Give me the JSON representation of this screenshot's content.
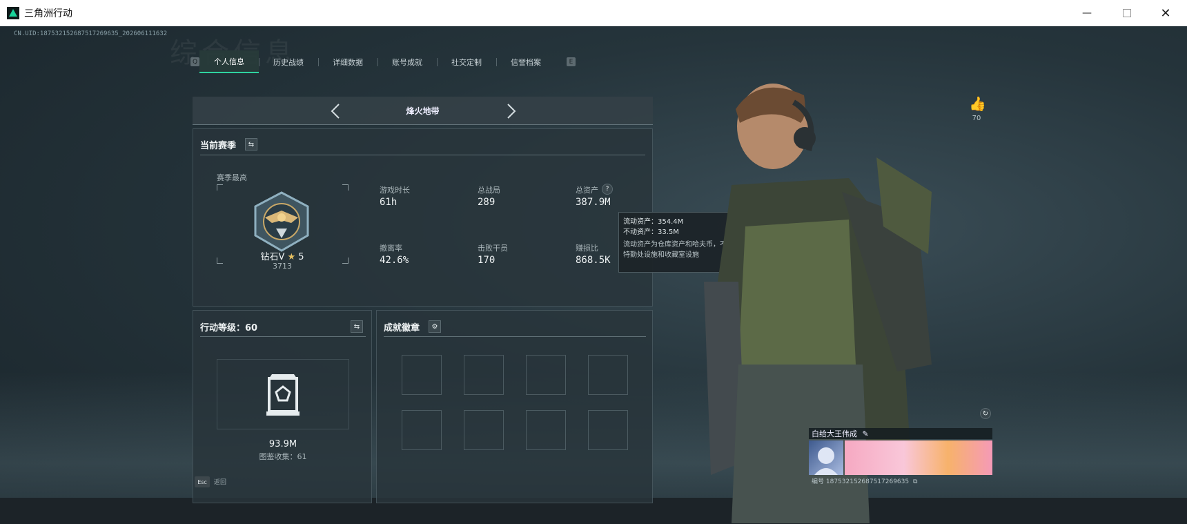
{
  "window": {
    "title": "三角洲行动",
    "minimize_icon": "minimize-icon",
    "maximize_icon": "maximize-icon",
    "close_icon": "close-icon"
  },
  "uid_text": "CN.UID:18753215268751726963​5_20260611163​2",
  "background_word": "综合信息",
  "tabs": {
    "prev_key": "Q",
    "next_key": "E",
    "items": [
      {
        "label": "个人信息",
        "active": true
      },
      {
        "label": "历史战绩",
        "active": false
      },
      {
        "label": "详细数据",
        "active": false
      },
      {
        "label": "账号成就",
        "active": false
      },
      {
        "label": "社交定制",
        "active": false
      },
      {
        "label": "信誉档案",
        "active": false
      }
    ]
  },
  "mode": {
    "title": "烽火地带",
    "prev_icon": "chevron-left-icon",
    "next_icon": "chevron-right-icon"
  },
  "season": {
    "title": "当前赛季",
    "switch_icon": "swap-icon",
    "highest_label": "赛季最高",
    "rank_name": "钻石V",
    "rank_stars": "5",
    "rank_points": "3713",
    "stats": [
      {
        "label": "游戏时长",
        "value": "61h"
      },
      {
        "label": "总战局",
        "value": "289"
      },
      {
        "label": "总资产",
        "value": "387.9M"
      },
      {
        "label": "撤离率",
        "value": "42.6%"
      },
      {
        "label": "击败干员",
        "value": "170"
      },
      {
        "label": "赚损比",
        "value": "868.5K"
      }
    ],
    "help_icon": "question-icon"
  },
  "tooltip": {
    "liquid": "流动资产：354.4M",
    "fixed": "不动资产：33.5M",
    "note": "流动资产为仓库资产和哈夫币，不动资产为特勤处设施和收藏室设施"
  },
  "level": {
    "title": "行动等级：60",
    "switch_icon": "swap-icon",
    "value": "93.9M",
    "collection_label": "图鉴收集：61"
  },
  "badges": {
    "title": "成就徽章",
    "settings_icon": "gear-icon",
    "slots": 8
  },
  "like": {
    "icon": "thumbs-up-icon",
    "count": "70"
  },
  "refresh_icon": "refresh-icon",
  "namecard": {
    "player_name": "白给大王伟成",
    "edit_icon": "pencil-icon",
    "id_label": "编号 18753215268751726963​5",
    "copy_icon": "copy-icon"
  },
  "footer": {
    "key": "Esc",
    "label": "返回"
  }
}
